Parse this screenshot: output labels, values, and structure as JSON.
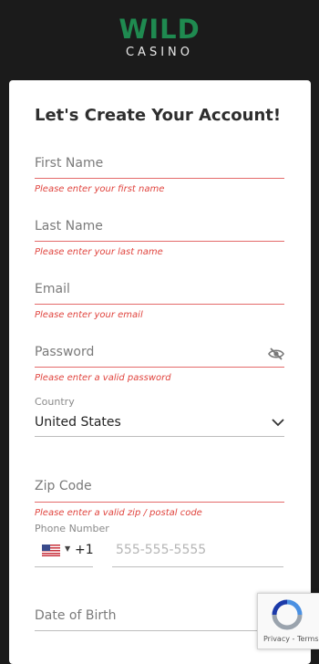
{
  "header": {
    "logo_main": "WILD",
    "logo_sub": "CASINO"
  },
  "form": {
    "title": "Let's Create Your Account!",
    "first_name": {
      "placeholder": "First Name",
      "error": "Please enter your first name"
    },
    "last_name": {
      "placeholder": "Last Name",
      "error": "Please enter your last name"
    },
    "email": {
      "placeholder": "Email",
      "error": "Please enter your email"
    },
    "password": {
      "placeholder": "Password",
      "error": "Please enter a valid password",
      "icon": "eye-slash-icon"
    },
    "country": {
      "label": "Country",
      "value": "United States",
      "icon": "chevron-down-icon"
    },
    "zip": {
      "placeholder": "Zip Code",
      "error": "Please enter a valid zip / postal code"
    },
    "phone": {
      "label": "Phone Number",
      "country_code": "+1",
      "placeholder": "555-555-5555",
      "flag": "us-flag-icon"
    },
    "dob": {
      "placeholder": "Date of Birth"
    }
  },
  "recaptcha": {
    "terms": "Privacy - Terms"
  },
  "colors": {
    "brand": "#1f8a50",
    "error": "#e0443e",
    "underline_error": "#e46a6a"
  }
}
